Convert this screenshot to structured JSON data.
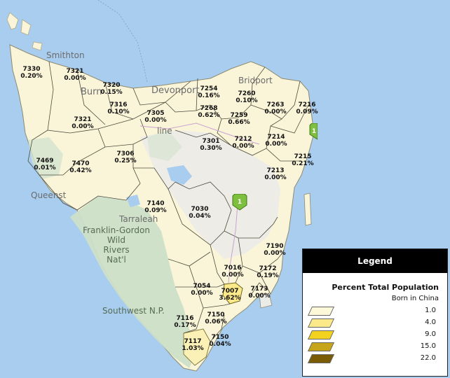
{
  "places": {
    "smithton": "Smithton",
    "burnie": "Burn",
    "devonport": "Devonport",
    "bridport": "Bridport",
    "queenstown": "Queenst",
    "tarraleah": "Tarraleah",
    "franklin": "Franklin-Gordon",
    "wild": "Wild",
    "rivers": "Rivers",
    "natl": "Nat'l",
    "southwest": "Southwest N.P.",
    "line": "line"
  },
  "regions": [
    {
      "code": "7330",
      "pct": "0.20%"
    },
    {
      "code": "7321",
      "pct": "0.00%"
    },
    {
      "code": "7320",
      "pct": "0.15%"
    },
    {
      "code": "7316",
      "pct": "0.10%"
    },
    {
      "code": "7321",
      "pct": "0.00%"
    },
    {
      "code": "7305",
      "pct": "0.00%"
    },
    {
      "code": "7254",
      "pct": "0.16%"
    },
    {
      "code": "7260",
      "pct": "0.10%"
    },
    {
      "code": "7263",
      "pct": "0.00%"
    },
    {
      "code": "7216",
      "pct": "0.09%"
    },
    {
      "code": "7268",
      "pct": "0.62%"
    },
    {
      "code": "7259",
      "pct": "0.66%"
    },
    {
      "code": "7214",
      "pct": "0.00%"
    },
    {
      "code": "7212",
      "pct": "0.00%"
    },
    {
      "code": "7301",
      "pct": "0.30%"
    },
    {
      "code": "7306",
      "pct": "0.25%"
    },
    {
      "code": "7469",
      "pct": "0.01%"
    },
    {
      "code": "7470",
      "pct": "0.42%"
    },
    {
      "code": "7215",
      "pct": "0.21%"
    },
    {
      "code": "7213",
      "pct": "0.00%"
    },
    {
      "code": "7140",
      "pct": "0.09%"
    },
    {
      "code": "7030",
      "pct": "0.04%"
    },
    {
      "code": "7190",
      "pct": "0.00%"
    },
    {
      "code": "7016",
      "pct": "0.00%"
    },
    {
      "code": "7172",
      "pct": "0.19%"
    },
    {
      "code": "7054",
      "pct": "0.00%"
    },
    {
      "code": "7007",
      "pct": "3.62%"
    },
    {
      "code": "7173",
      "pct": "0.00%"
    },
    {
      "code": "7116",
      "pct": "0.17%"
    },
    {
      "code": "7150",
      "pct": "0.06%"
    },
    {
      "code": "7117",
      "pct": "1.03%"
    },
    {
      "code": "7150",
      "pct": "0.04%"
    }
  ],
  "shields": {
    "route": "1"
  },
  "legend": {
    "header": "Legend",
    "title": "Percent Total Population",
    "subtitle": "Born in China",
    "items": [
      {
        "label": "1.0",
        "color": "#fdf8d8"
      },
      {
        "label": "4.0",
        "color": "#fce98a"
      },
      {
        "label": "9.0",
        "color": "#f2d11f"
      },
      {
        "label": "15.0",
        "color": "#c7a51a"
      },
      {
        "label": "22.0",
        "color": "#7a5c06"
      }
    ]
  },
  "colors": {
    "water": "#a9cdef",
    "land_low": "#faf5d9",
    "forest": "#c9ddc7",
    "grey_land": "#eaeaea",
    "border": "#4a4a4a"
  }
}
